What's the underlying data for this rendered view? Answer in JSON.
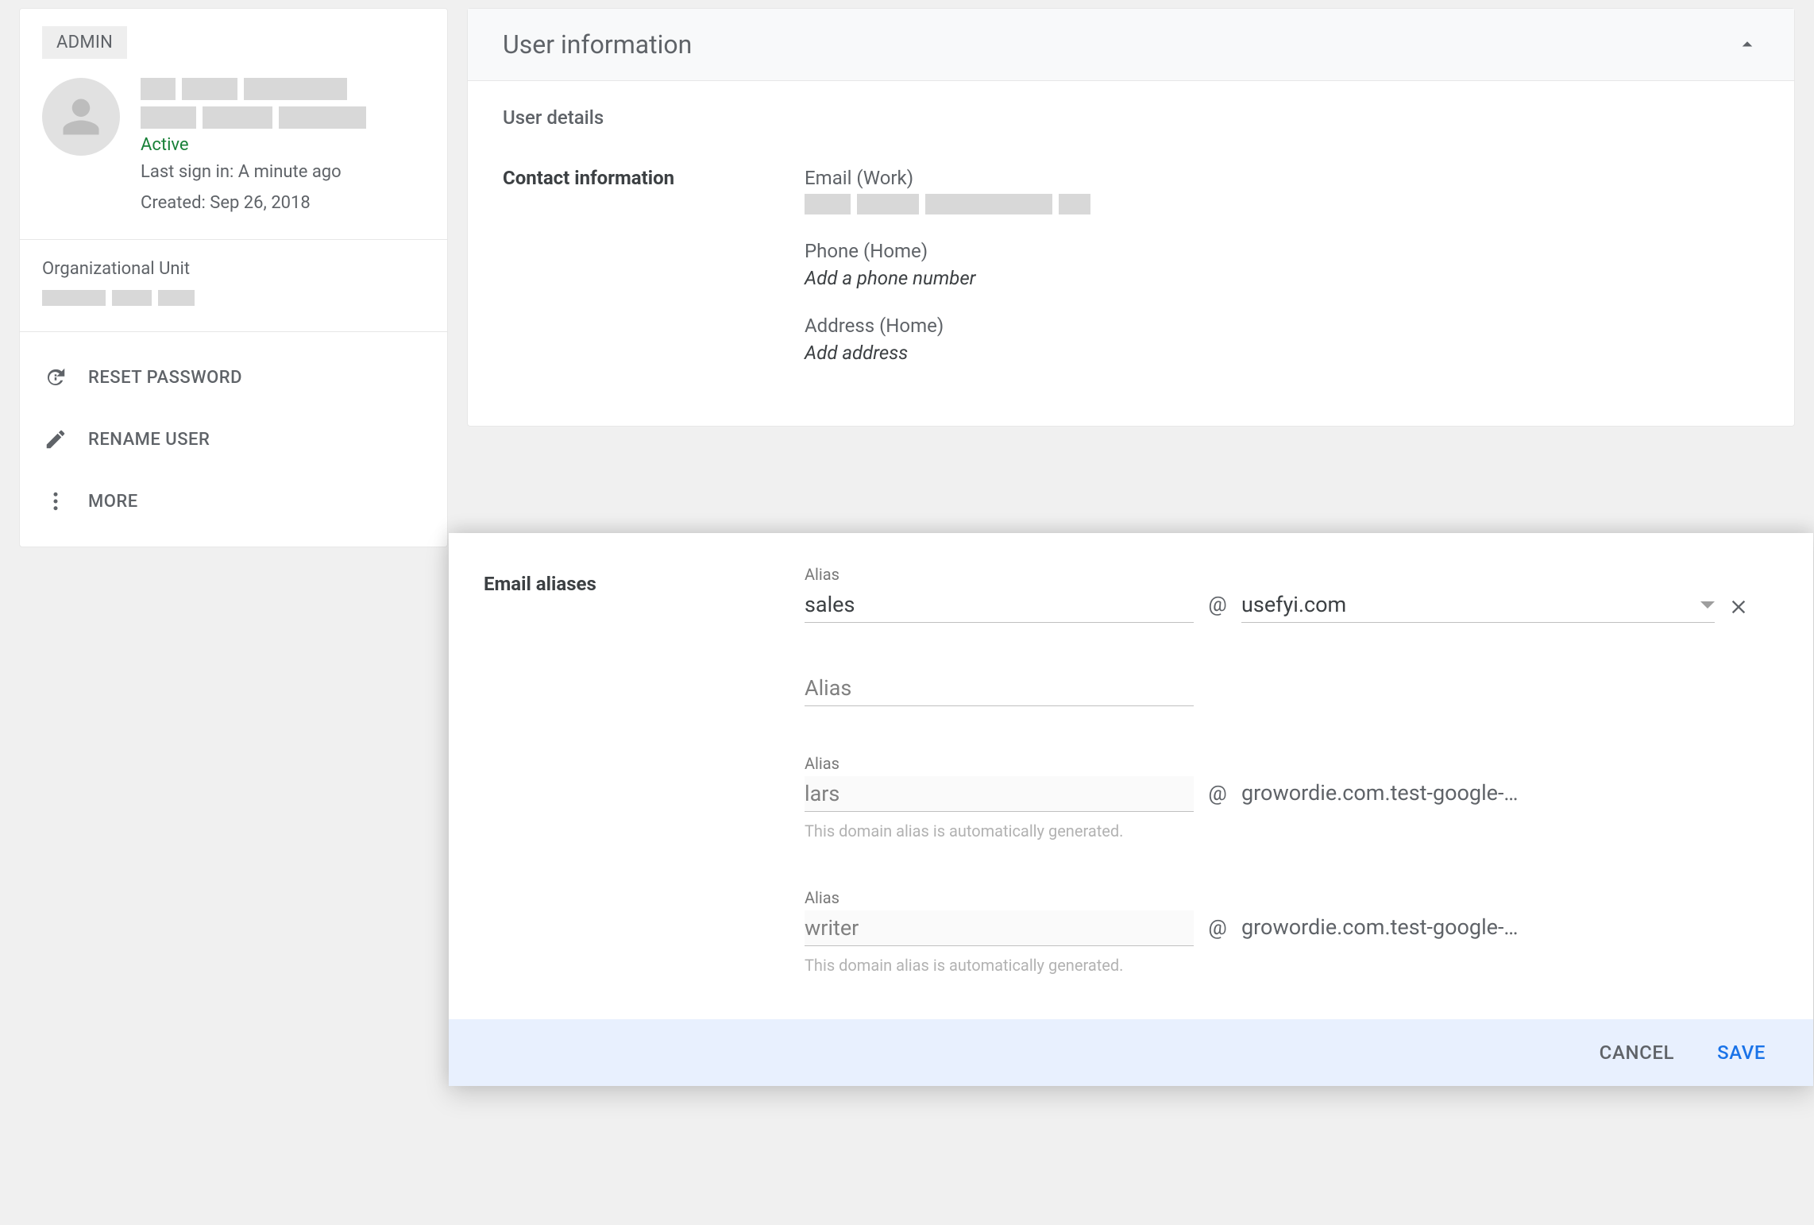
{
  "sidebar": {
    "badge": "ADMIN",
    "status": "Active",
    "last_signin": "Last sign in: A minute ago",
    "created": "Created: Sep 26, 2018",
    "org_unit_label": "Organizational Unit",
    "reset_password": "RESET PASSWORD",
    "rename_user": "RENAME USER",
    "more": "MORE"
  },
  "main": {
    "title": "User information",
    "user_details": "User details",
    "contact_label": "Contact information",
    "email_label": "Email (Work)",
    "phone_label": "Phone (Home)",
    "phone_placeholder": "Add a phone number",
    "address_label": "Address (Home)",
    "address_placeholder": "Add address"
  },
  "aliases": {
    "section_label": "Email aliases",
    "field_label": "Alias",
    "hint": "This domain alias is automatically generated.",
    "row1_value": "sales",
    "row1_domain": "usefyi.com",
    "row2_placeholder": "Alias",
    "row3_value": "lars",
    "row3_domain": "growordie.com.test-google-…",
    "row4_value": "writer",
    "row4_domain": "growordie.com.test-google-…",
    "cancel": "CANCEL",
    "save": "SAVE",
    "at": "@"
  }
}
